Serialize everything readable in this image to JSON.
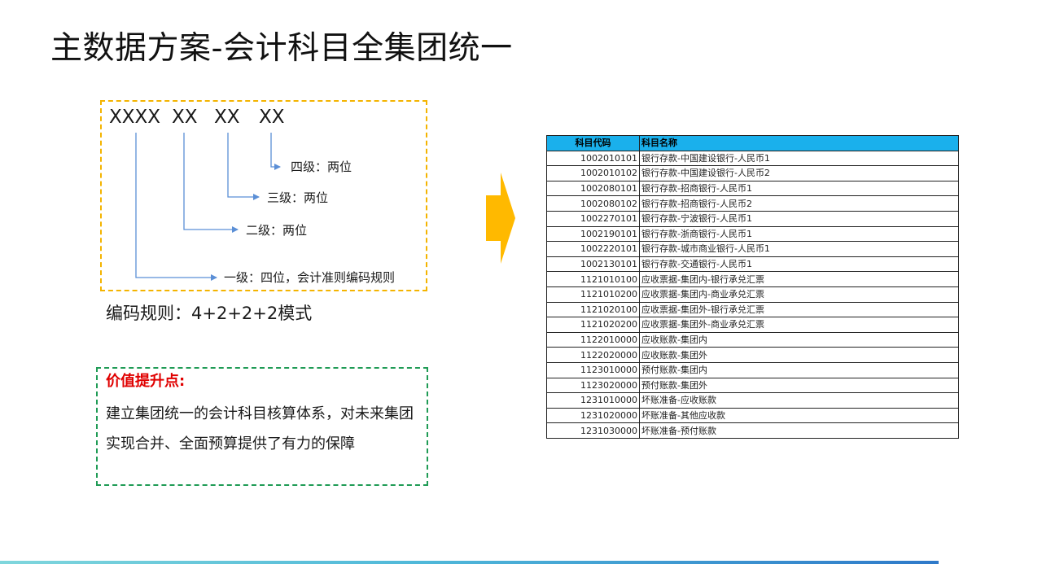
{
  "slide": {
    "title": "主数据方案-会计科目全集团统一"
  },
  "coding": {
    "segments": [
      "XXXX",
      "XX",
      "XX",
      "XX"
    ],
    "levels": [
      {
        "label": "四级：两位"
      },
      {
        "label": "三级：两位"
      },
      {
        "label": "二级：两位"
      },
      {
        "label": "一级：四位，会计准则编码规则"
      }
    ],
    "rule": "编码规则：4+2+2+2模式"
  },
  "value": {
    "title": "价值提升点:",
    "body": "建立集团统一的会计科目核算体系，对未来集团实现合并、全面预算提供了有力的保障"
  },
  "colors": {
    "code_box_border": "#f4b400",
    "value_box_border": "#1f9b55",
    "value_title": "#e00000",
    "arrow": "#ffb900",
    "table_header": "#1ab0ec",
    "tree_lines": "#5b8fd6"
  },
  "table": {
    "headers": {
      "code": "科目代码",
      "name": "科目名称"
    },
    "rows": [
      {
        "code": "1002010101",
        "name": "银行存款-中国建设银行-人民币1"
      },
      {
        "code": "1002010102",
        "name": "银行存款-中国建设银行-人民币2"
      },
      {
        "code": "1002080101",
        "name": "银行存款-招商银行-人民币1"
      },
      {
        "code": "1002080102",
        "name": "银行存款-招商银行-人民币2"
      },
      {
        "code": "1002270101",
        "name": "银行存款-宁波银行-人民币1"
      },
      {
        "code": "1002190101",
        "name": "银行存款-浙商银行-人民币1"
      },
      {
        "code": "1002220101",
        "name": "银行存款-城市商业银行-人民币1"
      },
      {
        "code": "1002130101",
        "name": "银行存款-交通银行-人民币1"
      },
      {
        "code": "1121010100",
        "name": "应收票据-集团内-银行承兑汇票"
      },
      {
        "code": "1121010200",
        "name": "应收票据-集团内-商业承兑汇票"
      },
      {
        "code": "1121020100",
        "name": "应收票据-集团外-银行承兑汇票"
      },
      {
        "code": "1121020200",
        "name": "应收票据-集团外-商业承兑汇票"
      },
      {
        "code": "1122010000",
        "name": "应收账款-集团内"
      },
      {
        "code": "1122020000",
        "name": "应收账款-集团外"
      },
      {
        "code": "1123010000",
        "name": "预付账款-集团内"
      },
      {
        "code": "1123020000",
        "name": "预付账款-集团外"
      },
      {
        "code": "1231010000",
        "name": "坏账准备-应收账款"
      },
      {
        "code": "1231020000",
        "name": "坏账准备-其他应收款"
      },
      {
        "code": "1231030000",
        "name": "坏账准备-预付账款"
      }
    ]
  }
}
